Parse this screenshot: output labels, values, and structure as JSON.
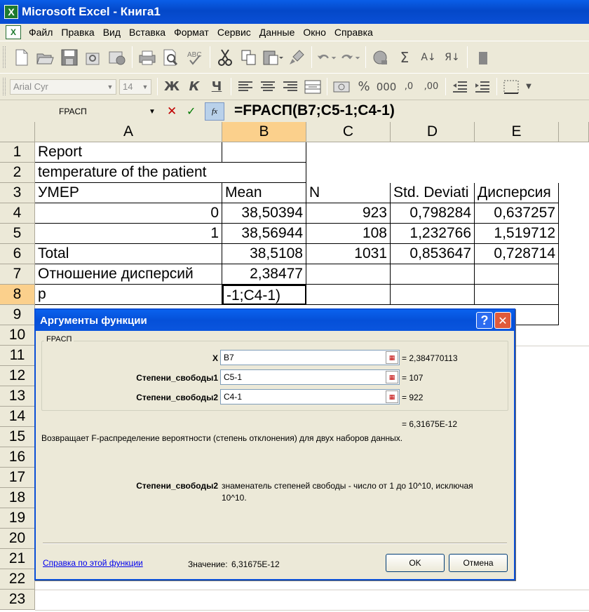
{
  "window": {
    "title": "Microsoft Excel - Книга1",
    "app_icon": "X"
  },
  "menu": {
    "doc_icon": "X",
    "items": [
      "Файл",
      "Правка",
      "Вид",
      "Вставка",
      "Формат",
      "Сервис",
      "Данные",
      "Окно",
      "Справка"
    ]
  },
  "toolbar1": {
    "buttons": [
      "new-icon",
      "open-icon",
      "save-icon",
      "permission-icon",
      "email-icon",
      "print-icon",
      "print-preview-icon",
      "spelling-icon",
      "cut-icon",
      "copy-icon",
      "paste-icon",
      "format-painter-icon",
      "undo-icon",
      "redo-icon",
      "hyperlink-icon",
      "autosum-icon",
      "sort-ascending-icon",
      "sort-descending-icon"
    ],
    "glyphs": {
      "autosum": "Σ",
      "sort_asc": "А↓",
      "sort_desc": "Я↓"
    }
  },
  "toolbar2": {
    "font_name": "Arial Cyr",
    "font_size": "14",
    "bold": "Ж",
    "italic": "К",
    "underline": "Ч",
    "percent": "%",
    "thousands": "000",
    "inc_decimal": ",0",
    "dec_decimal": ",00"
  },
  "formula_bar": {
    "name_box": "FPACП",
    "formula": "=FPACП(B7;C5-1;C4-1)"
  },
  "grid": {
    "columns": [
      "A",
      "B",
      "C",
      "D",
      "E"
    ],
    "rows": [
      "1",
      "2",
      "3",
      "4",
      "5",
      "6",
      "7",
      "8",
      "9",
      "10",
      "11",
      "12",
      "13",
      "14",
      "15",
      "16",
      "17",
      "18",
      "19",
      "20",
      "21",
      "22",
      "23"
    ],
    "cells": {
      "A1": "Report",
      "A2": "temperature of the patient",
      "A3": "УМЕР",
      "B3": "Mean",
      "C3": "N",
      "D3": "Std. Deviati",
      "E3": "Дисперсия",
      "A4": "0",
      "B4": "38,50394",
      "C4": "923",
      "D4": "0,798284",
      "E4": "0,637257",
      "A5": "1",
      "B5": "38,56944",
      "C5": "108",
      "D5": "1,232766",
      "E5": "1,519712",
      "A6": "Total",
      "B6": "38,5108",
      "C6": "1031",
      "D6": "0,853647",
      "E6": "0,728714",
      "A7": "Отношение дисперсий",
      "B7": "2,38477",
      "A8": "p",
      "B8": "-1;C4-1)"
    }
  },
  "dialog": {
    "title": "Аргументы функции",
    "help_glyph": "?",
    "close_glyph": "✕",
    "group_label": "FPACП",
    "args": [
      {
        "label": "X",
        "value": "B7",
        "result": "= 2,384770113"
      },
      {
        "label": "Степени_свободы1",
        "value": "C5-1",
        "result": "= 107"
      },
      {
        "label": "Степени_свободы2",
        "value": "C4-1",
        "result": "= 922"
      }
    ],
    "overall_result": "= 6,31675E-12",
    "description": "Возвращает F-распределение вероятности (степень отклонения) для двух наборов данных.",
    "arg_help_name": "Степени_свободы2",
    "arg_help_line1": "знаменатель степеней свободы - число от 1 до 10^10, исключая",
    "arg_help_line2": "10^10.",
    "help_link": "Справка по этой функции",
    "value_label": "Значение:",
    "value": "6,31675E-12",
    "ok_label": "OK",
    "cancel_label": "Отмена"
  }
}
